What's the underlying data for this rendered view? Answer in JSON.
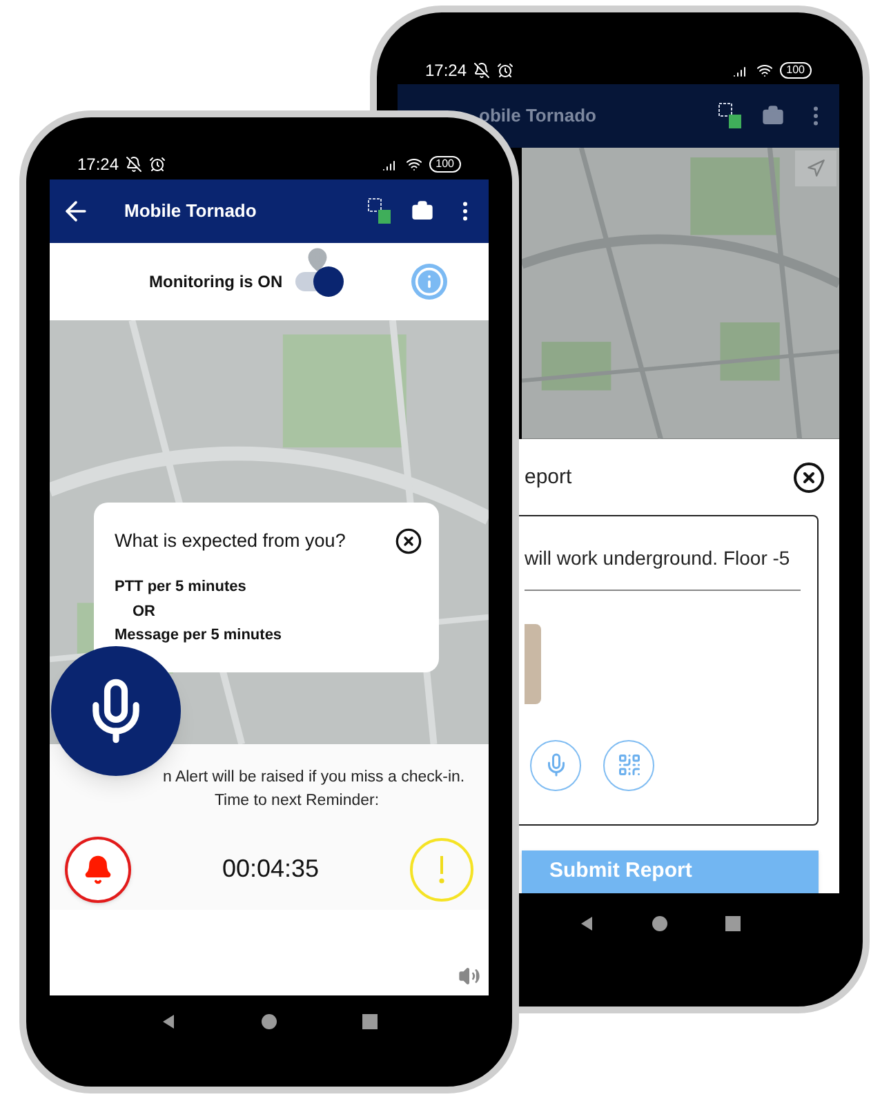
{
  "back_phone": {
    "status_bar": {
      "time": "17:24",
      "battery": "100"
    },
    "app_bar": {
      "title": "obile Tornado"
    },
    "report_dialog": {
      "title": "eport",
      "text": "will work underground. Floor -5",
      "submit_button": "Submit Report"
    }
  },
  "front_phone": {
    "status_bar": {
      "time": "17:24",
      "battery": "100"
    },
    "app_bar": {
      "title": "Mobile Tornado"
    },
    "monitoring": {
      "label": "Monitoring is ON",
      "on": true
    },
    "popup": {
      "title": "What is expected from you?",
      "lines": [
        {
          "text": "PTT per 5 minutes",
          "kind": "rule"
        },
        {
          "text": "OR",
          "kind": "separator"
        },
        {
          "text": "Message per 5 minutes",
          "kind": "rule"
        }
      ]
    },
    "checkin": {
      "notice": "n Alert will be raised if you miss a check-in.",
      "reminder_label": "Time to next Reminder:",
      "countdown": "00:04:35"
    }
  }
}
